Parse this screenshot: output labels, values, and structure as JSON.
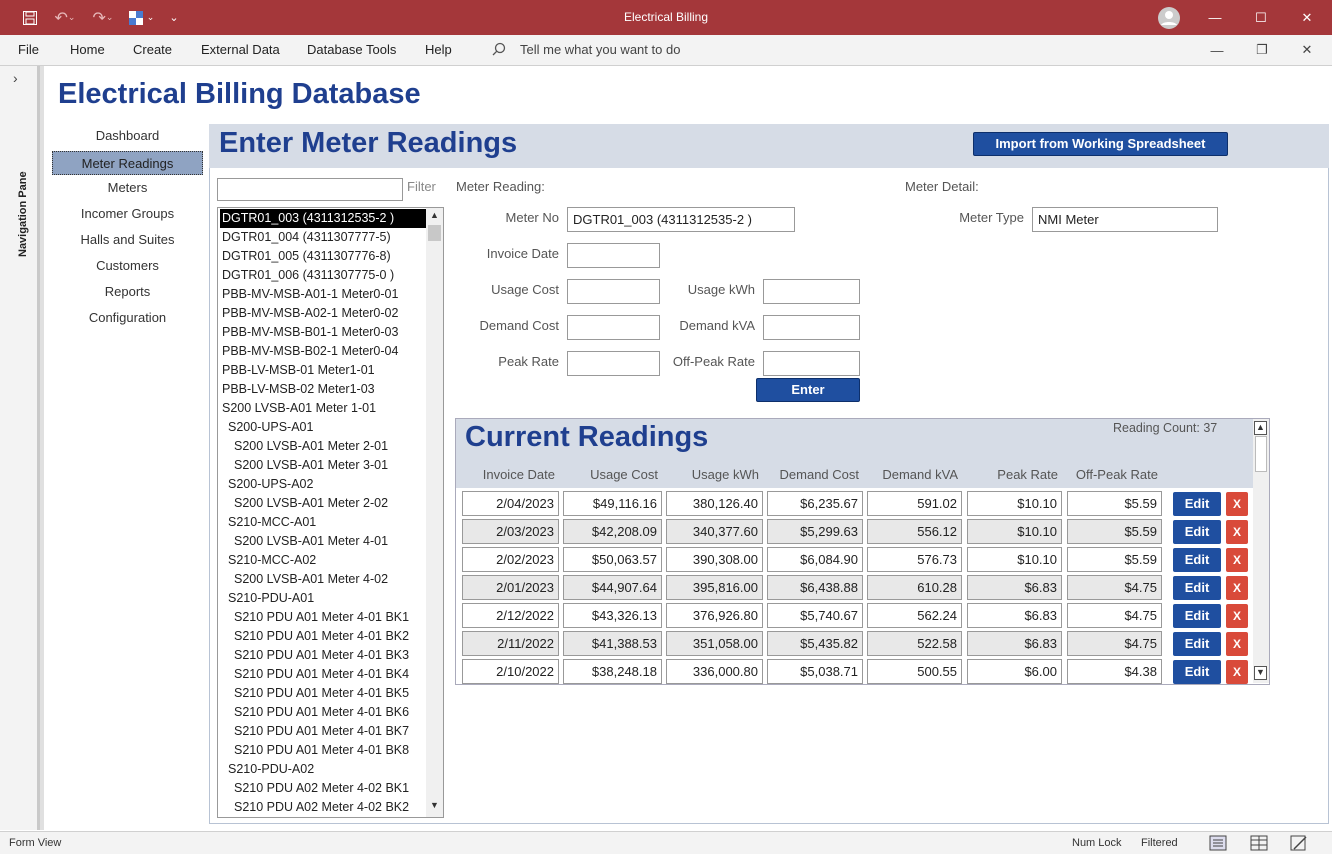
{
  "window": {
    "title": "Electrical Billing"
  },
  "menu": {
    "items": [
      "File",
      "Home",
      "Create",
      "External Data",
      "Database Tools",
      "Help"
    ],
    "tell_me": "Tell me what you want to do"
  },
  "nav_pane": {
    "label": "Navigation Pane"
  },
  "db_title": "Electrical Billing Database",
  "side_nav": {
    "items": [
      "Dashboard",
      "Meter Readings",
      "Meters",
      "Incomer Groups",
      "Halls and Suites",
      "Customers",
      "Reports",
      "Configuration"
    ],
    "active": "Meter Readings"
  },
  "form": {
    "title": "Enter Meter Readings",
    "import_button": "Import from Working Spreadsheet",
    "filter_label": "Filter",
    "filter_value": "",
    "meter_list": [
      "DGTR01_003 (4311312535-2 )",
      "DGTR01_004 (4311307777-5)",
      "DGTR01_005 (4311307776-8)",
      "DGTR01_006 (4311307775-0 )",
      "PBB-MV-MSB-A01-1 Meter0-01",
      "PBB-MV-MSB-A02-1 Meter0-02",
      "PBB-MV-MSB-B01-1 Meter0-03",
      "PBB-MV-MSB-B02-1 Meter0-04",
      "PBB-LV-MSB-01 Meter1-01",
      "PBB-LV-MSB-02 Meter1-03",
      "S200 LVSB-A01 Meter 1-01",
      "S200-UPS-A01",
      "S200 LVSB-A01 Meter 2-01",
      "S200 LVSB-A01 Meter 3-01",
      "S200-UPS-A02",
      "S200 LVSB-A01 Meter 2-02",
      "S210-MCC-A01",
      "S200 LVSB-A01 Meter 4-01",
      "S210-MCC-A02",
      "S200 LVSB-A01 Meter 4-02",
      "S210-PDU-A01",
      "S210 PDU A01 Meter 4-01 BK1",
      "S210 PDU A01 Meter 4-01 BK2",
      "S210 PDU A01 Meter 4-01 BK3",
      "S210 PDU A01 Meter 4-01 BK4",
      "S210 PDU A01 Meter 4-01 BK5",
      "S210 PDU A01 Meter 4-01 BK6",
      "S210 PDU A01 Meter 4-01 BK7",
      "S210 PDU A01 Meter 4-01 BK8",
      "S210-PDU-A02",
      "S210 PDU A02 Meter 4-02 BK1",
      "S210 PDU A02 Meter 4-02 BK2"
    ],
    "selected_meter": "DGTR01_003 (4311312535-2 )",
    "reading_section": "Meter Reading:",
    "detail_section": "Meter Detail:",
    "meter_no_label": "Meter No",
    "meter_no_value": "DGTR01_003 (4311312535-2 )",
    "meter_type_label": "Meter Type",
    "meter_type_value": "NMI Meter",
    "invoice_date_label": "Invoice Date",
    "usage_cost_label": "Usage Cost",
    "usage_kwh_label": "Usage kWh",
    "demand_cost_label": "Demand Cost",
    "demand_kva_label": "Demand kVA",
    "peak_rate_label": "Peak Rate",
    "offpeak_rate_label": "Off-Peak Rate",
    "enter_button": "Enter"
  },
  "readings": {
    "title": "Current Readings",
    "count_text": "Reading Count: 37",
    "columns": [
      "Invoice Date",
      "Usage Cost",
      "Usage kWh",
      "Demand Cost",
      "Demand kVA",
      "Peak Rate",
      "Off-Peak Rate"
    ],
    "rows": [
      [
        "2/04/2023",
        "$49,116.16",
        "380,126.40",
        "$6,235.67",
        "591.02",
        "$10.10",
        "$5.59"
      ],
      [
        "2/03/2023",
        "$42,208.09",
        "340,377.60",
        "$5,299.63",
        "556.12",
        "$10.10",
        "$5.59"
      ],
      [
        "2/02/2023",
        "$50,063.57",
        "390,308.00",
        "$6,084.90",
        "576.73",
        "$10.10",
        "$5.59"
      ],
      [
        "2/01/2023",
        "$44,907.64",
        "395,816.00",
        "$6,438.88",
        "610.28",
        "$6.83",
        "$4.75"
      ],
      [
        "2/12/2022",
        "$43,326.13",
        "376,926.80",
        "$5,740.67",
        "562.24",
        "$6.83",
        "$4.75"
      ],
      [
        "2/11/2022",
        "$41,388.53",
        "351,058.00",
        "$5,435.82",
        "522.58",
        "$6.83",
        "$4.75"
      ],
      [
        "2/10/2022",
        "$38,248.18",
        "336,000.80",
        "$5,038.71",
        "500.55",
        "$6.00",
        "$4.38"
      ]
    ],
    "edit_label": "Edit",
    "delete_label": "X"
  },
  "status": {
    "view": "Form View",
    "num_lock": "Num Lock",
    "filtered": "Filtered"
  },
  "colors": {
    "title_bar": "#a4373a",
    "heading_blue": "#1f3f8f",
    "button_blue": "#1f4fa0",
    "delete_red": "#d94a3a",
    "header_band": "#d6dce6"
  }
}
